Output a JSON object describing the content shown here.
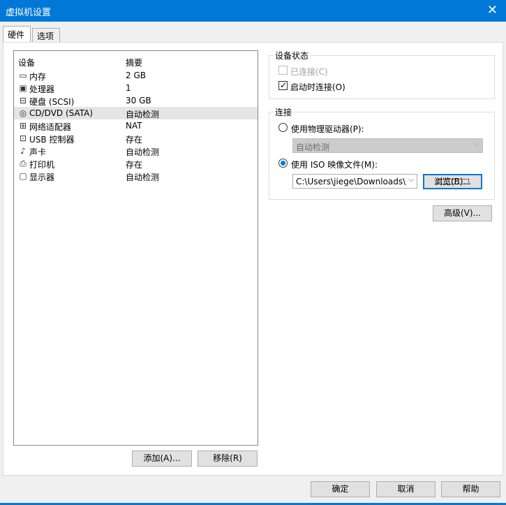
{
  "window": {
    "title": "虚拟机设置",
    "close_glyph": "✕"
  },
  "tabs": [
    {
      "label": "硬件"
    },
    {
      "label": "选项"
    }
  ],
  "device_list": {
    "headers": {
      "device": "设备",
      "summary": "摘要"
    },
    "rows": [
      {
        "icon": "memory-icon",
        "glyph": "▭",
        "name": "内存",
        "summary": "2 GB"
      },
      {
        "icon": "processor-icon",
        "glyph": "▣",
        "name": "处理器",
        "summary": "1"
      },
      {
        "icon": "hard-disk-icon",
        "glyph": "⊟",
        "name": "硬盘 (SCSI)",
        "summary": "30 GB"
      },
      {
        "icon": "cd-dvd-icon",
        "glyph": "◎",
        "name": "CD/DVD (SATA)",
        "summary": "自动检测"
      },
      {
        "icon": "network-adapter-icon",
        "glyph": "⊞",
        "name": "网络适配器",
        "summary": "NAT"
      },
      {
        "icon": "usb-controller-icon",
        "glyph": "⊡",
        "name": "USB 控制器",
        "summary": "存在"
      },
      {
        "icon": "sound-card-icon",
        "glyph": "♪",
        "name": "声卡",
        "summary": "自动检测"
      },
      {
        "icon": "printer-icon",
        "glyph": "⎙",
        "name": "打印机",
        "summary": "存在"
      },
      {
        "icon": "display-icon",
        "glyph": "▢",
        "name": "显示器",
        "summary": "自动检测"
      }
    ],
    "selected_index": 3
  },
  "list_buttons": {
    "add": "添加(A)...",
    "remove": "移除(R)"
  },
  "device_status": {
    "legend": "设备状态",
    "connected": {
      "label": "已连接(C)",
      "checked": false,
      "enabled": false
    },
    "connect_at_power_on": {
      "label": "启动时连接(O)",
      "checked": true,
      "enabled": true
    }
  },
  "connection": {
    "legend": "连接",
    "physical_drive": {
      "label": "使用物理驱动器(P):",
      "selected": false
    },
    "physical_drive_select": {
      "value": "自动检测",
      "enabled": false
    },
    "iso_image": {
      "label": "使用 ISO 映像文件(M):",
      "selected": true
    },
    "iso_path": {
      "value": "C:\\Users\\jiege\\Downloads\\u"
    },
    "browse_button": "浏览(B)..."
  },
  "advanced_button": "高级(V)...",
  "footer_buttons": {
    "ok": "确定",
    "cancel": "取消",
    "help": "帮助"
  },
  "colors": {
    "accent": "#0078d7",
    "selected_row": "#e5e5e5",
    "disabled_text": "#a0a0a0"
  }
}
